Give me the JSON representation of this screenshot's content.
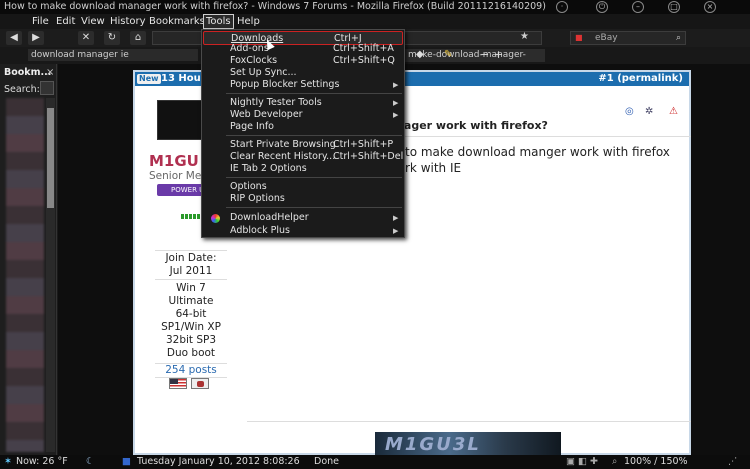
{
  "window": {
    "title": "How to make download manager work with firefox? - Windows 7 Forums - Mozilla Firefox (Build 20111216140209)"
  },
  "menubar": {
    "file": "File",
    "edit": "Edit",
    "view": "View",
    "history": "History",
    "bookmarks": "Bookmarks",
    "tools": "Tools",
    "help": "Help"
  },
  "nav": {
    "url": "",
    "search_placeholder": "eBay",
    "page_tab": "make-download-manager-"
  },
  "bookmarks_bar": {
    "url_text": "download manager ie"
  },
  "sidebar": {
    "title": "Bookm...",
    "close": "×",
    "search_label": "Search:"
  },
  "tools_menu": {
    "items": [
      {
        "label": "Downloads",
        "shortcut": "Ctrl+J"
      },
      {
        "label": "Add-ons",
        "shortcut": "Ctrl+Shift+A"
      },
      {
        "label": "FoxClocks",
        "shortcut": "Ctrl+Shift+Q"
      },
      {
        "label": "Set Up Sync...",
        "shortcut": ""
      },
      {
        "label": "Popup Blocker Settings",
        "shortcut": ""
      },
      {
        "label": "Nightly Tester Tools",
        "shortcut": ""
      },
      {
        "label": "Web Developer",
        "shortcut": ""
      },
      {
        "label": "Page Info",
        "shortcut": ""
      },
      {
        "label": "Start Private Browsing",
        "shortcut": "Ctrl+Shift+P"
      },
      {
        "label": "Clear Recent History...",
        "shortcut": "Ctrl+Shift+Del"
      },
      {
        "label": "IE Tab 2 Options",
        "shortcut": ""
      },
      {
        "label": "Options",
        "shortcut": ""
      },
      {
        "label": "RIP Options",
        "shortcut": ""
      },
      {
        "label": "DownloadHelper",
        "shortcut": ""
      },
      {
        "label": "Adblock Plus",
        "shortcut": ""
      }
    ]
  },
  "post": {
    "new_badge": "New",
    "time": "13 Hours",
    "permalink": "#1 (permalink)",
    "username": "M1GU",
    "user_title": "Senior Mem",
    "power_badge": "POWER U",
    "join_label": "Join Date:",
    "join_date": "Jul 2011",
    "specs": [
      "Win 7",
      "Ultimate",
      "64-bit",
      "SP1/Win XP",
      "32bit SP3",
      "Duo boot"
    ],
    "posts": "254 posts",
    "title": "ke download manager work with firefox?",
    "body_line1": "to make download manger work with firefox",
    "body_line2": "rk with IE",
    "signature": "M1GU3L"
  },
  "statusbar": {
    "weather": "Now: 26 °F",
    "datetime": "Tuesday  January 10, 2012  8:08:26",
    "status": "Done",
    "zoom": "100% / 150%"
  }
}
